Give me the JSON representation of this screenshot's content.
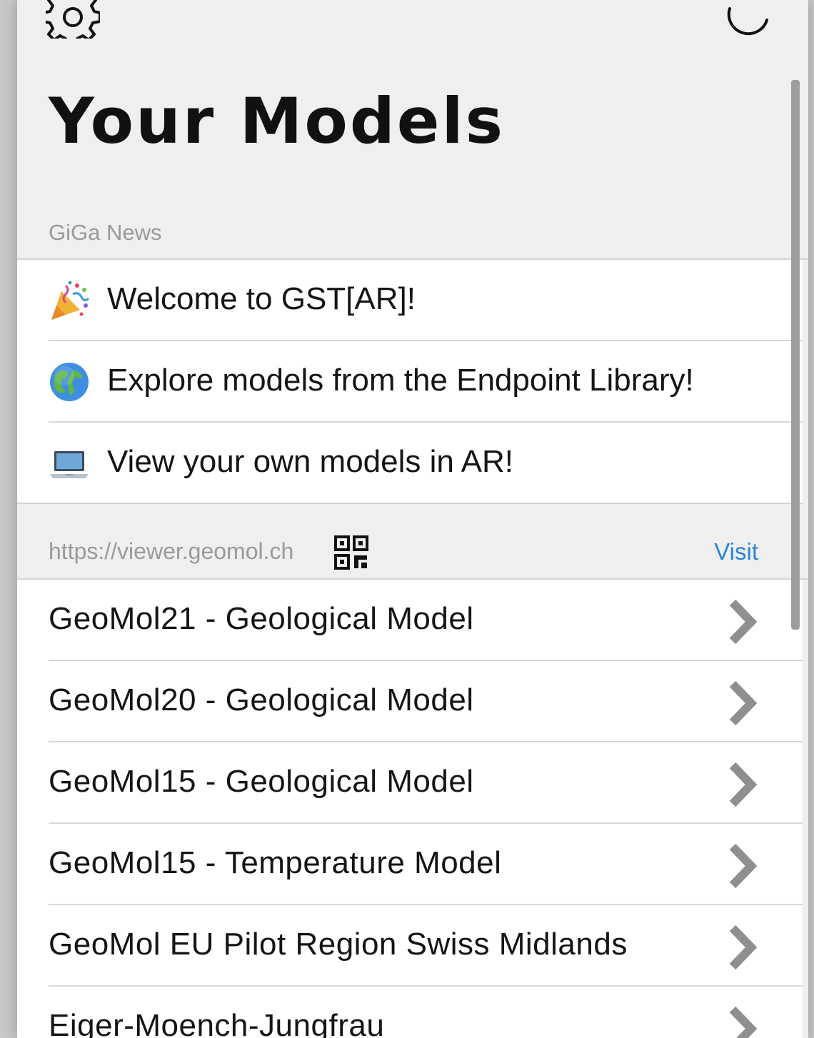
{
  "header": {
    "settings_icon": "gear-icon",
    "loading_icon": "spinner-icon",
    "title": "Your Models"
  },
  "news": {
    "section_label": "GiGa News",
    "items": [
      {
        "icon": "party-popper-icon",
        "text": "Welcome to GST[AR]!"
      },
      {
        "icon": "globe-icon",
        "text": "Explore models from the Endpoint Library!"
      },
      {
        "icon": "laptop-icon",
        "text": "View your own models in AR!"
      }
    ]
  },
  "endpoint": {
    "url": "https://viewer.geomol.ch",
    "qr_icon": "qr-code-icon",
    "visit_label": "Visit"
  },
  "models": [
    {
      "name": "GeoMol21 - Geological Model"
    },
    {
      "name": "GeoMol20 - Geological Model"
    },
    {
      "name": "GeoMol15 - Geological Model"
    },
    {
      "name": "GeoMol15 - Temperature Model"
    },
    {
      "name": "GeoMol EU Pilot Region Swiss Midlands"
    },
    {
      "name": "Eiger-Moench-Jungfrau"
    }
  ],
  "colors": {
    "accent": "#2a86d6",
    "background": "#efefef",
    "list_background": "#ffffff",
    "muted_text": "#9a9a9a",
    "chevron": "#8f8f8f"
  }
}
